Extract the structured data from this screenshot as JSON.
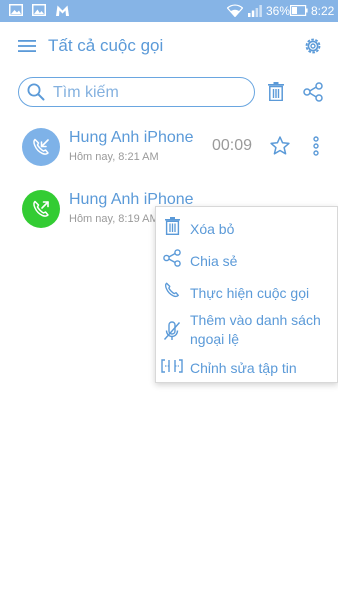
{
  "status_bar": {
    "battery_percent": "36%",
    "time": "8:22",
    "icons": [
      "gallery-icon",
      "image-icon",
      "malwarebytes-icon",
      "wifi-icon",
      "signal-icon",
      "battery-icon"
    ]
  },
  "app_bar": {
    "title": "Tất cả cuộc gọi",
    "menu_icon": "hamburger-menu-icon",
    "settings_icon": "gear-icon"
  },
  "search": {
    "placeholder": "Tìm kiếm",
    "icon": "search-icon"
  },
  "toolbar": {
    "delete_icon": "trash-icon",
    "share_icon": "share-icon"
  },
  "calls": [
    {
      "name": "Hung Anh iPhone",
      "time": "Hôm nay, 8:21 AM",
      "duration": "00:09",
      "type": "incoming",
      "avatar_color": "#7eb2e8",
      "starred": false
    },
    {
      "name": "Hung Anh iPhone",
      "time": "Hôm nay, 8:19 AM",
      "type": "outgoing",
      "avatar_color": "#33cc33",
      "starred": false
    }
  ],
  "context_menu": {
    "items": [
      {
        "label": "Xóa bỏ",
        "icon": "trash-icon"
      },
      {
        "label": "Chia sẻ",
        "icon": "share-icon"
      },
      {
        "label": "Thực hiện cuộc gọi",
        "icon": "phone-icon"
      },
      {
        "label": "Thêm vào danh sách",
        "label_line2": "ngoại lệ",
        "icon": "mic-off-icon"
      },
      {
        "label": "Chỉnh sửa tập tin",
        "icon": "trim-icon"
      }
    ]
  },
  "colors": {
    "accent": "#5b9ad8",
    "status_bar": "#86b4e6",
    "incoming_avatar": "#7eb2e8",
    "outgoing_avatar": "#33cc33",
    "secondary_text": "#9a9a9a"
  }
}
